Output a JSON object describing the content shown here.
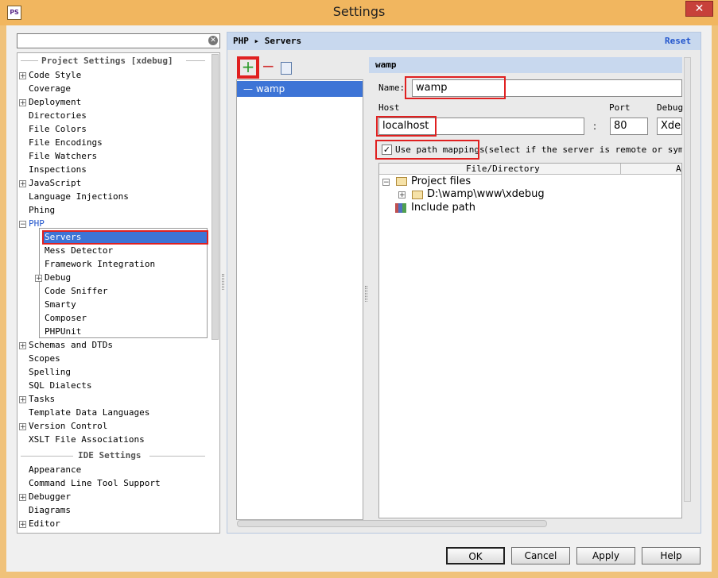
{
  "window": {
    "title": "Settings",
    "close": "✕",
    "app_icon": "PhpStorm-icon"
  },
  "sidebar": {
    "search": {
      "value": "",
      "placeholder": ""
    },
    "project_header": "Project Settings [xdebug]",
    "ide_header": "IDE Settings",
    "project_items": [
      {
        "label": "Code Style",
        "expandable": true
      },
      {
        "label": "Coverage",
        "expandable": false
      },
      {
        "label": "Deployment",
        "expandable": true
      },
      {
        "label": "Directories",
        "expandable": false
      },
      {
        "label": "File Colors",
        "expandable": false
      },
      {
        "label": "File Encodings",
        "expandable": false
      },
      {
        "label": "File Watchers",
        "expandable": false
      },
      {
        "label": "Inspections",
        "expandable": false
      },
      {
        "label": "JavaScript",
        "expandable": true
      },
      {
        "label": "Language Injections",
        "expandable": false
      },
      {
        "label": "Phing",
        "expandable": false
      },
      {
        "label": "PHP",
        "expandable": true,
        "expanded": true
      }
    ],
    "php_children": [
      {
        "label": "Servers",
        "selected": true
      },
      {
        "label": "Mess Detector"
      },
      {
        "label": "Framework Integration"
      },
      {
        "label": "Debug",
        "expandable": true
      },
      {
        "label": "Code Sniffer"
      },
      {
        "label": "Smarty"
      },
      {
        "label": "Composer"
      },
      {
        "label": "PHPUnit"
      }
    ],
    "project_items_after": [
      {
        "label": "Schemas and DTDs",
        "expandable": true
      },
      {
        "label": "Scopes",
        "expandable": false
      },
      {
        "label": "Spelling",
        "expandable": false
      },
      {
        "label": "SQL Dialects",
        "expandable": false
      },
      {
        "label": "Tasks",
        "expandable": true
      },
      {
        "label": "Template Data Languages",
        "expandable": false
      },
      {
        "label": "Version Control",
        "expandable": true
      },
      {
        "label": "XSLT File Associations",
        "expandable": false
      }
    ],
    "ide_items": [
      {
        "label": "Appearance",
        "expandable": false
      },
      {
        "label": "Command Line Tool Support",
        "expandable": false
      },
      {
        "label": "Debugger",
        "expandable": true
      },
      {
        "label": "Diagrams",
        "expandable": false
      },
      {
        "label": "Editor",
        "expandable": true
      }
    ]
  },
  "header": {
    "crumb_root": "PHP",
    "crumb_sep": "▸",
    "crumb_leaf": "Servers",
    "reset": "Reset"
  },
  "servers": {
    "add": "+",
    "remove": "−",
    "list": [
      {
        "label": "— wamp"
      }
    ]
  },
  "detail": {
    "title": "wamp",
    "name_label": "Name:",
    "name_value": "wamp",
    "host_label": "Host",
    "host_value": "localhost",
    "colon": ":",
    "port_label": "Port",
    "port_value": "80",
    "debugger_label": "Debug",
    "debugger_value": "Xdeb",
    "use_mappings_checked": true,
    "use_mappings_label": "Use path mappings",
    "use_mappings_hint": "(select if the server is remote or symlink",
    "table_col1": "File/Directory",
    "table_col2": "A",
    "tree": {
      "project_files": "Project files",
      "path": "D:\\wamp\\www\\xdebug",
      "include_path": "Include path"
    }
  },
  "buttons": {
    "ok": "OK",
    "cancel": "Cancel",
    "apply": "Apply",
    "help": "Help"
  },
  "colors": {
    "selection": "#3d74d6",
    "highlight_box": "#e02020",
    "title_bar": "#f1b65f"
  }
}
